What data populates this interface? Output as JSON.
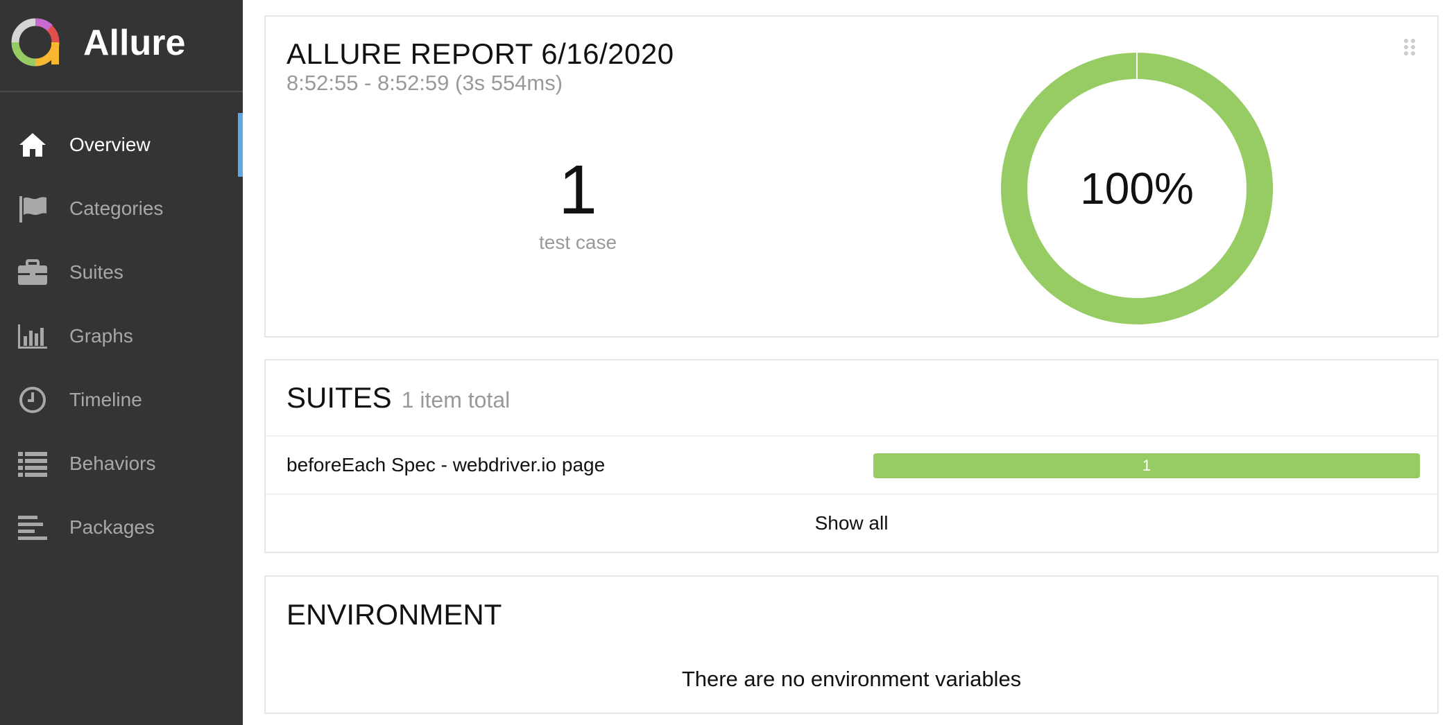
{
  "brand": {
    "name": "Allure"
  },
  "sidebar": {
    "items": [
      {
        "label": "Overview",
        "icon": "home-icon",
        "active": true
      },
      {
        "label": "Categories",
        "icon": "flag-icon",
        "active": false
      },
      {
        "label": "Suites",
        "icon": "briefcase-icon",
        "active": false
      },
      {
        "label": "Graphs",
        "icon": "bar-chart-icon",
        "active": false
      },
      {
        "label": "Timeline",
        "icon": "clock-icon",
        "active": false
      },
      {
        "label": "Behaviors",
        "icon": "list-icon",
        "active": false
      },
      {
        "label": "Packages",
        "icon": "align-left-icon",
        "active": false
      }
    ],
    "active_color": "#5fa8e8"
  },
  "summary": {
    "title": "ALLURE REPORT 6/16/2020",
    "time_range": "8:52:55 - 8:52:59 (3s 554ms)",
    "test_count": "1",
    "test_count_label": "test case",
    "pass_percent_label": "100%",
    "pass_fraction": 1.0,
    "pass_color": "#97cc64"
  },
  "suites": {
    "title": "SUITES",
    "subtitle": "1 item total",
    "rows": [
      {
        "name": "beforeEach Spec - webdriver.io page",
        "passed": "1"
      }
    ],
    "show_all_label": "Show all"
  },
  "environment": {
    "title": "ENVIRONMENT",
    "empty_message": "There are no environment variables"
  }
}
